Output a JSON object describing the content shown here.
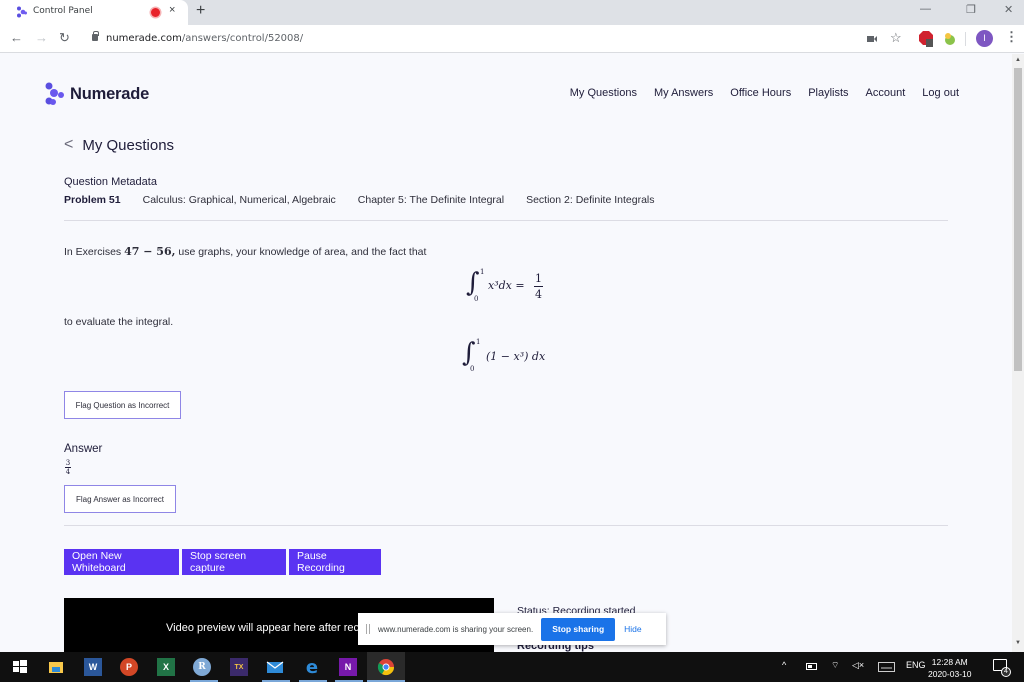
{
  "browser": {
    "tab_title": "Control Panel",
    "url_domain": "numerade.com",
    "url_path": "/answers/control/52008/",
    "profile_initial": "I",
    "new_tab_symbol": "+",
    "tab_close_symbol": "×"
  },
  "site": {
    "brand": "Numerade",
    "brand_color": "#5a33f2",
    "nav": [
      "My Questions",
      "My Answers",
      "Office Hours",
      "Playlists",
      "Account",
      "Log out"
    ]
  },
  "page": {
    "back_label": "My Questions",
    "metadata_title": "Question Metadata",
    "metadata": {
      "problem": "Problem 51",
      "book": "Calculus: Graphical, Numerical, Algebraic",
      "chapter": "Chapter 5: The Definite Integral",
      "section": "Section 2: Definite Integrals"
    },
    "question": {
      "intro_before": "In Exercises ",
      "intro_math": "47 − 56,",
      "intro_after": " use graphs, your knowledge of area, and the fact that",
      "given_integral": {
        "lower": "0",
        "upper": "1",
        "integrand": "x³dx =",
        "result_num": "1",
        "result_den": "4"
      },
      "middle_text": "to evaluate the integral.",
      "target_integral": {
        "lower": "0",
        "upper": "1",
        "integrand": "(1 − x³) dx"
      }
    },
    "flag_question_label": "Flag Question as Incorrect",
    "answer_label": "Answer",
    "answer": {
      "num": "3",
      "den": "4"
    },
    "flag_answer_label": "Flag Answer as Incorrect",
    "actions": [
      "Open New Whiteboard",
      "Stop screen capture",
      "Pause Recording"
    ],
    "video_placeholder": "Video preview will appear here after recording",
    "status_text": "Status: Recording started",
    "recording_tips_title": "Recording tips"
  },
  "share_banner": {
    "message": "www.numerade.com is sharing your screen.",
    "stop_label": "Stop sharing",
    "hide_label": "Hide"
  },
  "taskbar": {
    "apps": [
      "start",
      "file-explorer",
      "word",
      "powerpoint",
      "excel",
      "r",
      "texstudio",
      "mail",
      "edge",
      "onenote",
      "chrome"
    ],
    "language": "ENG",
    "time": "12:28 AM",
    "date": "2020-03-10",
    "notifications": "4"
  }
}
